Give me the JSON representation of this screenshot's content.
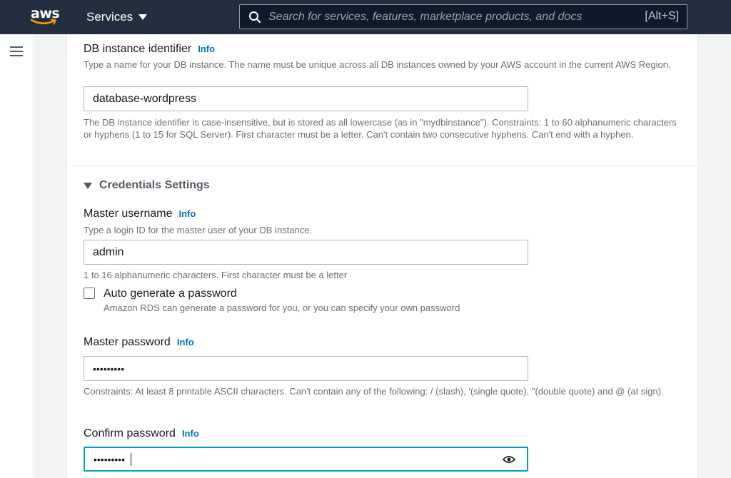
{
  "topbar": {
    "logo_text": "aws",
    "services_label": "Services",
    "search_placeholder": "Search for services, features, marketplace products, and docs",
    "search_shortcut": "[Alt+S]"
  },
  "form": {
    "db_identifier": {
      "label": "DB instance identifier",
      "info": "Info",
      "description": "Type a name for your DB instance. The name must be unique across all DB instances owned by your AWS account in the current AWS Region.",
      "value": "database-wordpress",
      "constraints": "The DB instance identifier is case-insensitive, but is stored as all lowercase (as in \"mydbinstance\"). Constraints: 1 to 60 alphanumeric characters or hyphens (1 to 15 for SQL Server). First character must be a letter. Can't contain two consecutive hyphens. Can't end with a hyphen."
    },
    "credentials": {
      "title": "Credentials Settings",
      "master_username": {
        "label": "Master username",
        "info": "Info",
        "description": "Type a login ID for the master user of your DB instance.",
        "value": "admin",
        "constraints": "1 to 16 alphanumeric characters. First character must be a letter"
      },
      "auto_generate": {
        "label": "Auto generate a password",
        "description": "Amazon RDS can generate a password for you, or you can specify your own password",
        "checked": false
      },
      "master_password": {
        "label": "Master password",
        "info": "Info",
        "value": "•••••••••",
        "constraints": "Constraints: At least 8 printable ASCII characters. Can't contain any of the following: / (slash), '(single quote), \"(double quote) and @ (at sign)."
      },
      "confirm_password": {
        "label": "Confirm password",
        "info": "Info",
        "value": "•••••••••"
      }
    }
  },
  "colors": {
    "nav_bg": "#232f3e",
    "link": "#0073bb",
    "focus": "#00a1c9",
    "aws_smile": "#ff9900"
  },
  "icons": [
    "search-icon",
    "caret-down-icon",
    "hamburger-menu-icon",
    "triangle-down-icon",
    "eye-icon"
  ]
}
